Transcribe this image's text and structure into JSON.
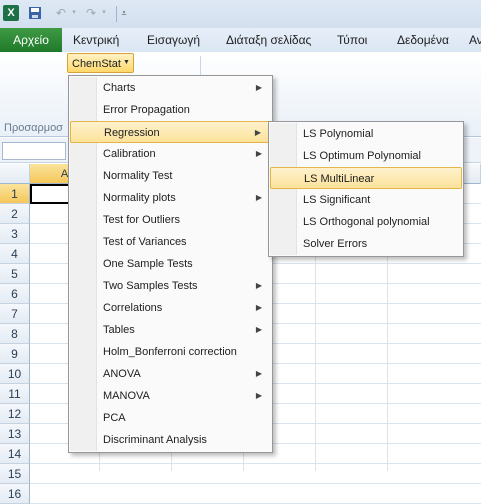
{
  "quick_access": {
    "app_icon": "X",
    "save_icon": "save-icon",
    "undo_icon": "undo-icon",
    "redo_icon": "redo-icon"
  },
  "ribbon_tabs": [
    "Αρχείο",
    "Κεντρική",
    "Εισαγωγή",
    "Διάταξη σελίδας",
    "Τύποι",
    "Δεδομένα",
    "Αν"
  ],
  "ribbon": {
    "chemstat_label": "ChemStat",
    "group_label": "Προσαρμοσ"
  },
  "grid": {
    "selected_column": "A",
    "rows": [
      "1",
      "2",
      "3",
      "4",
      "5",
      "6",
      "7",
      "8",
      "9",
      "10",
      "11",
      "12",
      "13",
      "14",
      "15",
      "16"
    ]
  },
  "main_menu": [
    {
      "label": "Charts",
      "submenu": true
    },
    {
      "label": "Error Propagation",
      "submenu": false
    },
    {
      "label": "Regression",
      "submenu": true
    },
    {
      "label": "Calibration",
      "submenu": true
    },
    {
      "label": "Normality Test",
      "submenu": false
    },
    {
      "label": "Normality plots",
      "submenu": true
    },
    {
      "label": "Test for Outliers",
      "submenu": false
    },
    {
      "label": "Test of Variances",
      "submenu": false
    },
    {
      "label": "One Sample Tests",
      "submenu": false
    },
    {
      "label": "Two Samples Tests",
      "submenu": true
    },
    {
      "label": "Correlations",
      "submenu": true
    },
    {
      "label": "Tables",
      "submenu": true
    },
    {
      "label": "Holm_Bonferroni correction",
      "submenu": false
    },
    {
      "label": "ANOVA",
      "submenu": true
    },
    {
      "label": "MANOVA",
      "submenu": true
    },
    {
      "label": "PCA",
      "submenu": false
    },
    {
      "label": "Discriminant Analysis",
      "submenu": false
    }
  ],
  "main_menu_highlight_index": 2,
  "regression_submenu": [
    "LS Polynomial",
    "LS Optimum Polynomial",
    "LS MultiLinear",
    "LS Significant",
    "LS Orthogonal polynomial",
    "Solver Errors"
  ],
  "regression_submenu_highlight_index": 2,
  "colors": {
    "file_tab": "#1f7a2a",
    "highlight": "#fce29a",
    "header_selected": "#f5c75a"
  }
}
